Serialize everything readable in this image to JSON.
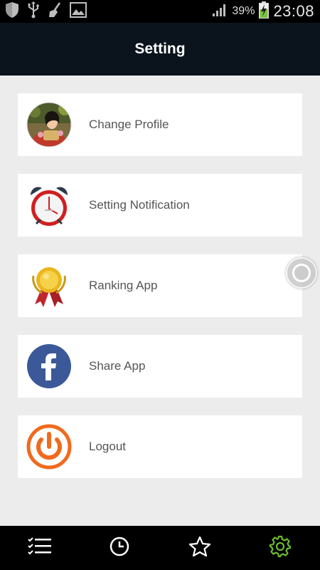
{
  "status_bar": {
    "battery_percent": "39%",
    "time": "23:08",
    "icons": [
      "shield-icon",
      "usb-icon",
      "broom-icon",
      "image-icon",
      "signal-icon",
      "battery-charging-icon"
    ]
  },
  "header": {
    "title": "Setting"
  },
  "menu": [
    {
      "label": "Change Profile",
      "icon": "profile-photo-avatar"
    },
    {
      "label": "Setting Notification",
      "icon": "alarm-clock-icon"
    },
    {
      "label": "Ranking App",
      "icon": "medal-icon"
    },
    {
      "label": "Share App",
      "icon": "facebook-icon"
    },
    {
      "label": "Logout",
      "icon": "power-icon"
    }
  ],
  "bottom_nav": {
    "items": [
      "list-icon",
      "clock-icon",
      "star-icon",
      "gear-icon"
    ],
    "active": "gear-icon",
    "active_color": "#6dbb2f"
  },
  "colors": {
    "header_bg": "#0b141c",
    "page_bg": "#ececec",
    "logout_orange": "#f06a1d",
    "facebook_blue": "#3b5998"
  }
}
